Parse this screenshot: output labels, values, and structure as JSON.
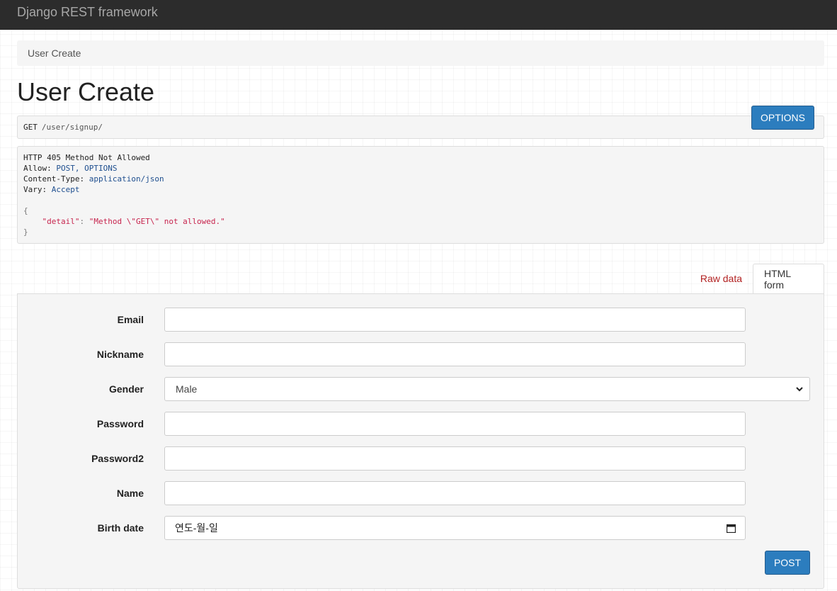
{
  "navbar": {
    "brand": "Django REST framework"
  },
  "breadcrumb": {
    "current": "User Create"
  },
  "page": {
    "title": "User Create",
    "options_label": "OPTIONS"
  },
  "request": {
    "method": "GET",
    "url": "/user/signup/"
  },
  "response": {
    "status_line": "HTTP 405 Method Not Allowed",
    "headers": [
      {
        "key": "Allow:",
        "value": "POST, OPTIONS"
      },
      {
        "key": "Content-Type:",
        "value": "application/json"
      },
      {
        "key": "Vary:",
        "value": "Accept"
      }
    ],
    "body_open": "{",
    "body_key": "\"detail\"",
    "body_colon": ": ",
    "body_value": "\"Method \\\"GET\\\" not allowed.\"",
    "body_close": "}"
  },
  "tabs": {
    "raw": "Raw data",
    "html": "HTML form"
  },
  "form": {
    "email_label": "Email",
    "nickname_label": "Nickname",
    "gender_label": "Gender",
    "gender_value": "Male",
    "password_label": "Password",
    "password2_label": "Password2",
    "name_label": "Name",
    "birth_label": "Birth date",
    "birth_placeholder": "연도-월-일",
    "submit_label": "POST"
  },
  "colors": {
    "navbar": "#2c2c2c",
    "primary_button": "#2c7dbe",
    "raw_tab": "#b22222",
    "json_string": "#c7254e"
  }
}
